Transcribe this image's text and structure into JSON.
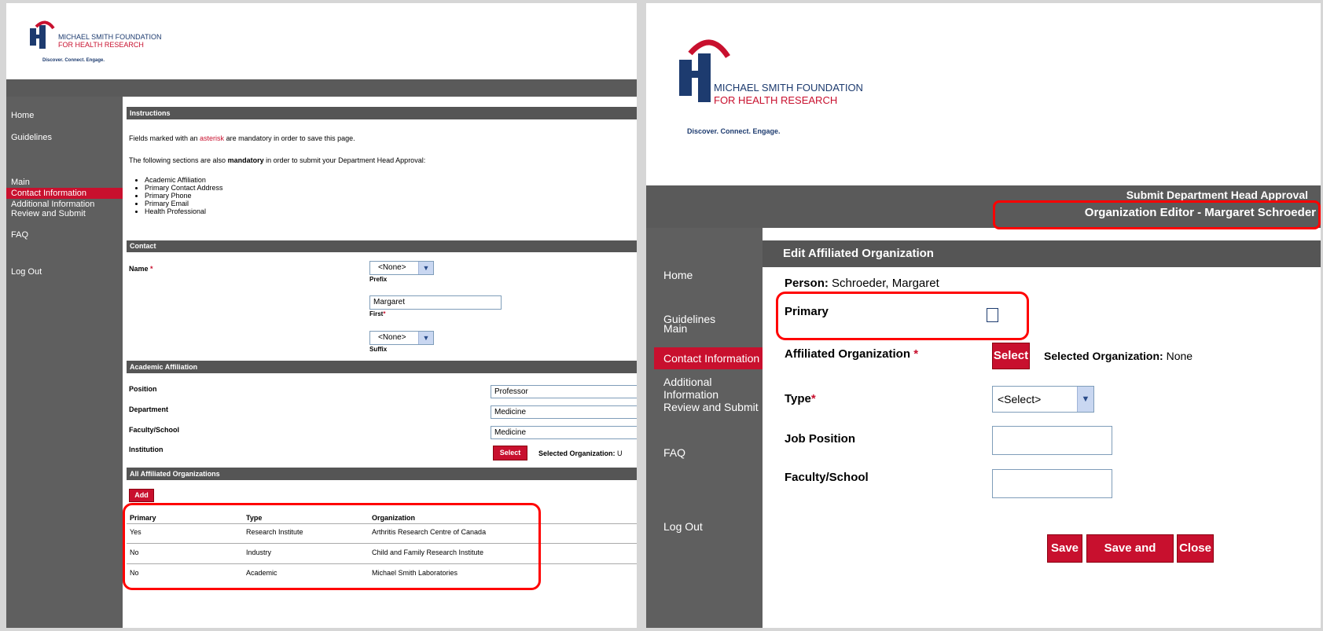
{
  "logo": {
    "line1": "MICHAEL SMITH FOUNDATION",
    "line2": "FOR HEALTH RESEARCH",
    "tagline": "Discover. Connect. Engage."
  },
  "left": {
    "nav": {
      "home": "Home",
      "guidelines": "Guidelines",
      "main": "Main",
      "contact": "Contact Information",
      "additional": "Additional Information",
      "review": "Review and Submit",
      "faq": "FAQ",
      "logout": "Log Out"
    },
    "instructions": {
      "header": "Instructions",
      "line1_pre": "Fields marked with an ",
      "line1_link": "asterisk",
      "line1_post": " are mandatory in order to save this page.",
      "line2_pre": "The following sections are also ",
      "line2_bold": "mandatory",
      "line2_post": " in order to submit your Department Head Approval:",
      "bullets": [
        "Academic Affiliation",
        "Primary Contact Address",
        "Primary Phone",
        "Primary Email",
        "Health Professional"
      ]
    },
    "contact": {
      "header": "Contact",
      "name_label": "Name",
      "prefix_value": "<None>",
      "prefix_label": "Prefix",
      "first_value": "Margaret",
      "first_label": "First",
      "suffix_value": "<None>",
      "suffix_label": "Suffix"
    },
    "academic": {
      "header": "Academic Affiliation",
      "position_label": "Position",
      "position_value": "Professor",
      "department_label": "Department",
      "department_value": "Medicine",
      "faculty_label": "Faculty/School",
      "faculty_value": "Medicine",
      "institution_label": "Institution",
      "select_button": "Select",
      "selected_org_label": "Selected Organization:",
      "selected_org_value": "U"
    },
    "affiliated": {
      "header": "All Affiliated Organizations",
      "add_button": "Add",
      "columns": [
        "Primary",
        "Type",
        "Organization"
      ],
      "rows": [
        [
          "Yes",
          "Research Institute",
          "Arthritis Research Centre of Canada"
        ],
        [
          "No",
          "Industry",
          "Child and Family Research Institute"
        ],
        [
          "No",
          "Academic",
          "Michael Smith Laboratories"
        ]
      ]
    }
  },
  "right": {
    "header_title": "Submit Department Head Approval",
    "header_subtitle": "Organization Editor  -  Margaret Schroeder",
    "nav": {
      "home": "Home",
      "guidelines": "Guidelines",
      "main": "Main",
      "contact": "Contact Information",
      "additional": "Additional Information",
      "review": "Review and Submit",
      "faq": "FAQ",
      "logout": "Log Out"
    },
    "form": {
      "header": "Edit Affiliated Organization",
      "person_label": "Person:",
      "person_value": "Schroeder, Margaret",
      "primary_label": "Primary",
      "affiliated_label": "Affiliated Organization",
      "select_button": "Select",
      "selected_org_label": "Selected Organization:",
      "selected_org_value": "None",
      "type_label": "Type",
      "type_value": "<Select>",
      "job_label": "Job Position",
      "faculty_label": "Faculty/School",
      "save": "Save",
      "save_close": "Save and Close",
      "close": "Close"
    }
  },
  "colors": {
    "accent": "#c8102e",
    "sidebar": "#5f5f5f",
    "header": "#555555",
    "highlight": "#ff0000"
  }
}
